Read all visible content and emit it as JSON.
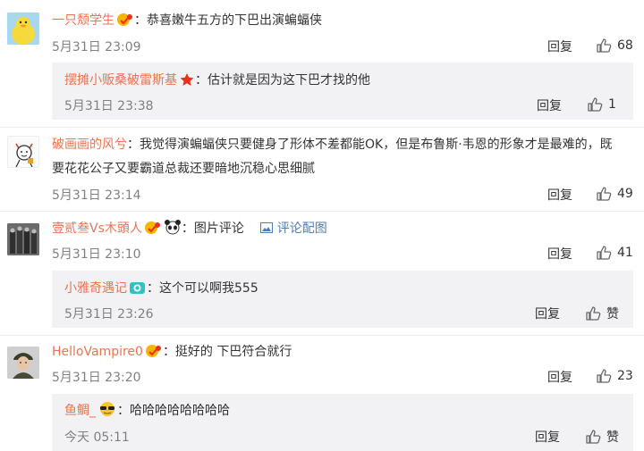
{
  "comments": [
    {
      "user": "一只颓学生",
      "text": "：恭喜嫩牛五方的下巴出演蝙蝠侠",
      "time": "5月31日 23:09",
      "reply_label": "回复",
      "likes": "68",
      "sub": {
        "user": "摆摊小贩桑破雷斯基",
        "text": "：估计就是因为这下巴才找的他",
        "time": "5月31日 23:38",
        "reply_label": "回复",
        "likes": "1"
      }
    },
    {
      "user": "破画画的风兮",
      "text": "：我觉得演蝙蝠侠只要健身了形体不差都能OK，但是布鲁斯·韦恩的形象才是最难的，既要花花公子又要霸道总裁还要暗地沉稳心思细腻",
      "time": "5月31日 23:14",
      "reply_label": "回复",
      "likes": "49"
    },
    {
      "user": "壹贰叁Vs木頭人",
      "text": "：图片评论",
      "image_link": "评论配图",
      "time": "5月31日 23:10",
      "reply_label": "回复",
      "likes": "41",
      "sub": {
        "user": "小雅奇遇记",
        "text": "：这个可以啊我555",
        "time": "5月31日 23:26",
        "reply_label": "回复",
        "likes": "赞"
      }
    },
    {
      "user": "HelloVampire0",
      "text": "：挺好的 下巴符合就行",
      "time": "5月31日 23:20",
      "reply_label": "回复",
      "likes": "23",
      "sub": {
        "user": "鱼鲷_",
        "text": "：哈哈哈哈哈哈哈哈",
        "time": "今天 05:11",
        "reply_label": "回复",
        "likes": "赞"
      }
    }
  ],
  "icons": {
    "thumb": "thumbs-up-icon",
    "image": "image-icon"
  },
  "colors": {
    "username": "#eb7350",
    "link": "#507daf",
    "reply_bg": "#f2f2f5",
    "time": "#808080"
  }
}
